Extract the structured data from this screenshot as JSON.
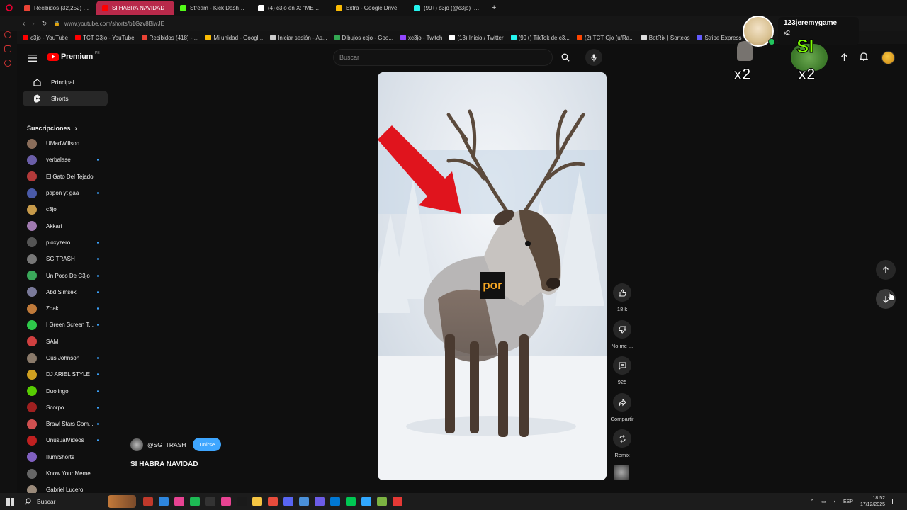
{
  "browser": {
    "tabs": [
      {
        "label": "Recibidos (32,252) - jose",
        "color": "#ea4335"
      },
      {
        "label": "SI HABRA NAVIDAD",
        "color": "#ff0000",
        "active": true
      },
      {
        "label": "Stream - Kick Dashboard",
        "color": "#53fc18"
      },
      {
        "label": "(4) c3jo en X: \"ME VICIE",
        "color": "#ffffff"
      },
      {
        "label": "Extra - Google Drive",
        "color": "#fbbc04"
      },
      {
        "label": "(99+) c3jo (@c3jo) | TikTok",
        "color": "#25f4ee"
      }
    ],
    "new_tab_label": "+",
    "url": "www.youtube.com/shorts/b1Gzv8BiwJE",
    "bookmarks": [
      {
        "label": "c3jo - YouTube",
        "color": "#ff0000"
      },
      {
        "label": "TCT C3jo - YouTube",
        "color": "#ff0000"
      },
      {
        "label": "Recibidos (418) - ...",
        "color": "#ea4335"
      },
      {
        "label": "Mi unidad - Googl...",
        "color": "#fbbc04"
      },
      {
        "label": "Iniciar sesión - As...",
        "color": "#cccccc"
      },
      {
        "label": "Dibujos cejo - Goo...",
        "color": "#34a853"
      },
      {
        "label": "xc3jo - Twitch",
        "color": "#9146ff"
      },
      {
        "label": "(13) Inicio / Twitter",
        "color": "#ffffff"
      },
      {
        "label": "(99+) TikTok de c3...",
        "color": "#25f4ee"
      },
      {
        "label": "(2) TCT Cjo (u/Ra...",
        "color": "#ff4500"
      },
      {
        "label": "BotRix | Sorteos",
        "color": "#dddddd"
      },
      {
        "label": "Stripe Express",
        "color": "#635bff"
      }
    ]
  },
  "youtube": {
    "logo_label": "Premium",
    "logo_badge": "PE",
    "search_placeholder": "Buscar",
    "nav": [
      {
        "label": "Principal",
        "icon": "home-icon"
      },
      {
        "label": "Shorts",
        "icon": "shorts-icon",
        "active": true
      }
    ],
    "subscriptions_label": "Suscripciones",
    "subscriptions": [
      {
        "name": "UMadWillson",
        "color": "#8a6d5a",
        "dot": false
      },
      {
        "name": "verbalase",
        "color": "#6b5ea8",
        "dot": true
      },
      {
        "name": "El Gato Del Tejado",
        "color": "#b33a3a",
        "dot": false
      },
      {
        "name": "papon yt gaa",
        "color": "#4a5aa8",
        "dot": true
      },
      {
        "name": "c3jo",
        "color": "#c79a4a",
        "dot": false
      },
      {
        "name": "Akkari",
        "color": "#a07ab0",
        "dot": false
      },
      {
        "name": "ploxyzero",
        "color": "#555555",
        "dot": true
      },
      {
        "name": "SG TRASH",
        "color": "#777777",
        "dot": true
      },
      {
        "name": "Un Poco De C3jo",
        "color": "#3aa85a",
        "dot": true
      },
      {
        "name": "Abd Simsek",
        "color": "#7a7a9a",
        "dot": true
      },
      {
        "name": "Zdak",
        "color": "#c07a3a",
        "dot": true
      },
      {
        "name": "I Green Screen T...",
        "color": "#2ec84a",
        "dot": true
      },
      {
        "name": "SAM",
        "color": "#d04040",
        "dot": false
      },
      {
        "name": "Gus Johnson",
        "color": "#8a7a6a",
        "dot": true
      },
      {
        "name": "DJ ARIEL STYLE",
        "color": "#d0a020",
        "dot": true
      },
      {
        "name": "Duolingo",
        "color": "#58cc02",
        "dot": true
      },
      {
        "name": "Scorpo",
        "color": "#a02020",
        "dot": true
      },
      {
        "name": "Brawl Stars Com...",
        "color": "#d05050",
        "dot": true
      },
      {
        "name": "UnusualVideos",
        "color": "#c02020",
        "dot": true
      },
      {
        "name": "IlumiShorts",
        "color": "#8060c0",
        "dot": false
      },
      {
        "name": "Know Your Meme",
        "color": "#666666",
        "dot": false
      },
      {
        "name": "Gabriel Lucero",
        "color": "#9a8a7a",
        "dot": false
      }
    ],
    "short": {
      "channel": "@SG_TRASH",
      "join_label": "Unirse",
      "title": "SI HABRA NAVIDAD",
      "overlay_text": "por"
    },
    "actions": [
      {
        "label": "18 k",
        "icon": "like-icon"
      },
      {
        "label": "No me ...",
        "icon": "dislike-icon"
      },
      {
        "label": "925",
        "icon": "comment-icon"
      },
      {
        "label": "Compartir",
        "icon": "share-icon"
      },
      {
        "label": "Remix",
        "icon": "remix-icon"
      }
    ]
  },
  "stream_overlay": {
    "username": "123jeremygame",
    "badge": "x2",
    "emote_text": "SI",
    "multiplier_left": "x2",
    "multiplier_right": "x2"
  },
  "taskbar": {
    "search_label": "Buscar",
    "language": "ESP",
    "time": "18:52",
    "date": "17/12/2025",
    "app_colors": [
      "#c0392b",
      "#2e86de",
      "#e84393",
      "#1db954",
      "#333333",
      "#e84393",
      "#1a1a1a",
      "#f5c542",
      "#e74c3c",
      "#5865f2",
      "#4a90d9",
      "#6c5ce7",
      "#0078d4",
      "#00c853",
      "#31a8ff",
      "#7cb342",
      "#e53935"
    ]
  }
}
